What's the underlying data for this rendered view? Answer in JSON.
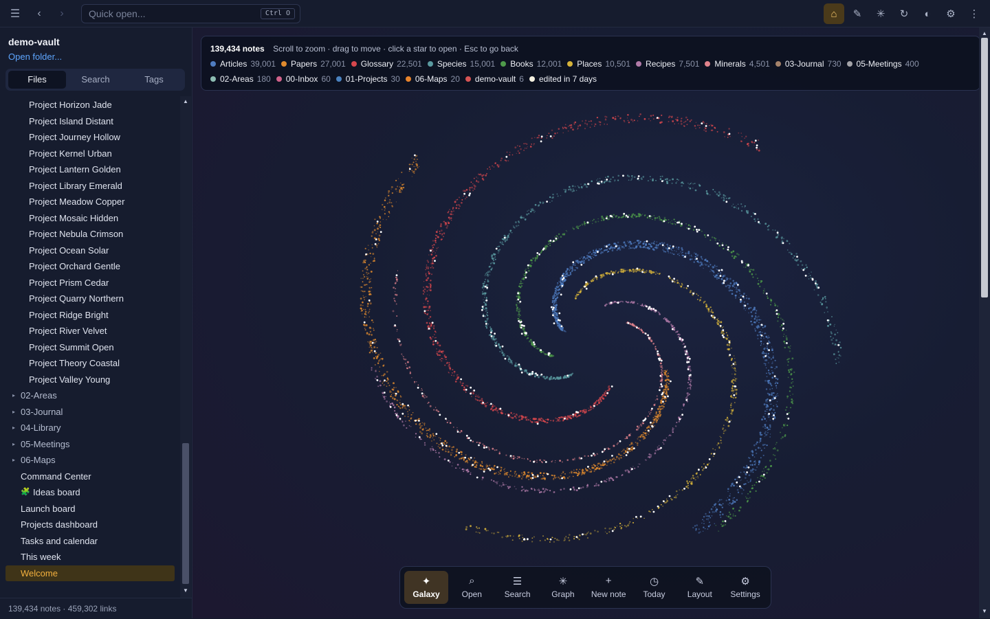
{
  "topbar": {
    "quick_open_placeholder": "Quick open...",
    "quick_open_shortcut": "Ctrl O",
    "menu_icon": "menu-icon",
    "back_icon": "chevron-left-icon",
    "forward_icon": "chevron-right-icon",
    "right_icons": [
      "home-icon",
      "pen-icon",
      "graph-icon",
      "refresh-icon",
      "contrast-icon",
      "gear-icon",
      "more-vertical-icon"
    ]
  },
  "sidebar": {
    "vault_name": "demo-vault",
    "open_folder": "Open folder...",
    "tabs": [
      "Files",
      "Search",
      "Tags"
    ],
    "active_tab": "Files",
    "files": [
      {
        "label": "Project Horizon Jade",
        "indent": 2
      },
      {
        "label": "Project Island Distant",
        "indent": 2
      },
      {
        "label": "Project Journey Hollow",
        "indent": 2
      },
      {
        "label": "Project Kernel Urban",
        "indent": 2
      },
      {
        "label": "Project Lantern Golden",
        "indent": 2
      },
      {
        "label": "Project Library Emerald",
        "indent": 2
      },
      {
        "label": "Project Meadow Copper",
        "indent": 2
      },
      {
        "label": "Project Mosaic Hidden",
        "indent": 2
      },
      {
        "label": "Project Nebula Crimson",
        "indent": 2
      },
      {
        "label": "Project Ocean Solar",
        "indent": 2
      },
      {
        "label": "Project Orchard Gentle",
        "indent": 2
      },
      {
        "label": "Project Prism Cedar",
        "indent": 2
      },
      {
        "label": "Project Quarry Northern",
        "indent": 2
      },
      {
        "label": "Project Ridge Bright",
        "indent": 2
      },
      {
        "label": "Project River Velvet",
        "indent": 2
      },
      {
        "label": "Project Summit Open",
        "indent": 2
      },
      {
        "label": "Project Theory Coastal",
        "indent": 2
      },
      {
        "label": "Project Valley Young",
        "indent": 2
      },
      {
        "label": "02-Areas",
        "indent": 1,
        "folder": true
      },
      {
        "label": "03-Journal",
        "indent": 1,
        "folder": true
      },
      {
        "label": "04-Library",
        "indent": 1,
        "folder": true
      },
      {
        "label": "05-Meetings",
        "indent": 1,
        "folder": true
      },
      {
        "label": "06-Maps",
        "indent": 1,
        "folder": true
      },
      {
        "label": "Command Center",
        "indent": 1
      },
      {
        "label": "Ideas board",
        "indent": 1,
        "emoji": "🧩"
      },
      {
        "label": "Launch board",
        "indent": 1
      },
      {
        "label": "Projects dashboard",
        "indent": 1
      },
      {
        "label": "Tasks and calendar",
        "indent": 1
      },
      {
        "label": "This week",
        "indent": 1
      },
      {
        "label": "Welcome",
        "indent": 1,
        "active": true
      }
    ],
    "status": "139,434 notes · 459,302 links"
  },
  "legend": {
    "count": "139,434 notes",
    "hint": "Scroll to zoom · drag to move · click a star to open · Esc to go back",
    "rows": [
      [
        {
          "name": "Articles",
          "count": "39,001",
          "color": "#4f7cc0"
        },
        {
          "name": "Papers",
          "count": "27,001",
          "color": "#e08a2e"
        },
        {
          "name": "Glossary",
          "count": "22,501",
          "color": "#d6474d"
        },
        {
          "name": "Species",
          "count": "15,001",
          "color": "#5a9aa0"
        },
        {
          "name": "Books",
          "count": "12,001",
          "color": "#4e9a4a"
        },
        {
          "name": "Places",
          "count": "10,501",
          "color": "#d6b33a"
        },
        {
          "name": "Recipes",
          "count": "7,501",
          "color": "#b07aa8"
        },
        {
          "name": "Minerals",
          "count": "4,501",
          "color": "#e0828c"
        },
        {
          "name": "03-Journal",
          "count": "730",
          "color": "#a4826a"
        },
        {
          "name": "05-Meetings",
          "count": "400",
          "color": "#a3a3a8"
        }
      ],
      [
        {
          "name": "02-Areas",
          "count": "180",
          "color": "#8cbcb2"
        },
        {
          "name": "00-Inbox",
          "count": "60",
          "color": "#d0628a"
        },
        {
          "name": "01-Projects",
          "count": "30",
          "color": "#4a82bf"
        },
        {
          "name": "06-Maps",
          "count": "20",
          "color": "#e8842c"
        },
        {
          "name": "demo-vault",
          "count": "6",
          "color": "#d65454"
        },
        {
          "name": "edited in 7 days",
          "count": "",
          "color": "#f4f0e0"
        }
      ]
    ]
  },
  "dock": [
    {
      "label": "Galaxy",
      "glyph": "✦",
      "icon": "sparkle-icon",
      "active": true
    },
    {
      "label": "Open",
      "glyph": "⌕",
      "icon": "search-icon"
    },
    {
      "label": "Search",
      "glyph": "☰",
      "icon": "list-icon"
    },
    {
      "label": "Graph",
      "glyph": "✳",
      "icon": "graph-icon"
    },
    {
      "label": "New note",
      "glyph": "+",
      "icon": "plus-icon"
    },
    {
      "label": "Today",
      "glyph": "◷",
      "icon": "clock-icon"
    },
    {
      "label": "Layout",
      "glyph": "✎",
      "icon": "pen-icon"
    },
    {
      "label": "Settings",
      "glyph": "⚙",
      "icon": "gear-icon"
    }
  ],
  "galaxy_arms": [
    {
      "color": "#4f7cc0"
    },
    {
      "color": "#e08a2e"
    },
    {
      "color": "#d6474d"
    },
    {
      "color": "#5a9aa0"
    },
    {
      "color": "#4e9a4a"
    },
    {
      "color": "#d6b33a"
    },
    {
      "color": "#b07aa8"
    },
    {
      "color": "#e0828c"
    }
  ]
}
